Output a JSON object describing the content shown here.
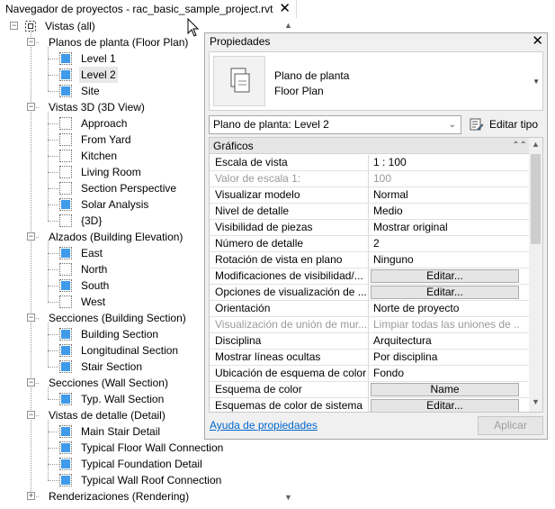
{
  "browser": {
    "title": "Navegador de proyectos - rac_basic_sample_project.rvt",
    "tree": [
      {
        "label": "Vistas (all)",
        "level": 0,
        "type": "group-root"
      },
      {
        "label": "Planos de planta (Floor Plan)",
        "level": 1,
        "type": "group"
      },
      {
        "label": "Level 1",
        "level": 2,
        "type": "view",
        "icon": "blue"
      },
      {
        "label": "Level 2",
        "level": 2,
        "type": "view",
        "icon": "blue",
        "selected": true
      },
      {
        "label": "Site",
        "level": 2,
        "type": "view",
        "icon": "blue"
      },
      {
        "label": "Vistas 3D (3D View)",
        "level": 1,
        "type": "group"
      },
      {
        "label": "Approach",
        "level": 2,
        "type": "view",
        "icon": "empty"
      },
      {
        "label": "From Yard",
        "level": 2,
        "type": "view",
        "icon": "empty"
      },
      {
        "label": "Kitchen",
        "level": 2,
        "type": "view",
        "icon": "empty"
      },
      {
        "label": "Living Room",
        "level": 2,
        "type": "view",
        "icon": "empty"
      },
      {
        "label": "Section Perspective",
        "level": 2,
        "type": "view",
        "icon": "empty"
      },
      {
        "label": "Solar Analysis",
        "level": 2,
        "type": "view",
        "icon": "blue"
      },
      {
        "label": "{3D}",
        "level": 2,
        "type": "view",
        "icon": "empty"
      },
      {
        "label": "Alzados (Building Elevation)",
        "level": 1,
        "type": "group"
      },
      {
        "label": "East",
        "level": 2,
        "type": "view",
        "icon": "blue"
      },
      {
        "label": "North",
        "level": 2,
        "type": "view",
        "icon": "empty"
      },
      {
        "label": "South",
        "level": 2,
        "type": "view",
        "icon": "blue"
      },
      {
        "label": "West",
        "level": 2,
        "type": "view",
        "icon": "empty"
      },
      {
        "label": "Secciones (Building Section)",
        "level": 1,
        "type": "group"
      },
      {
        "label": "Building Section",
        "level": 2,
        "type": "view",
        "icon": "blue"
      },
      {
        "label": "Longitudinal Section",
        "level": 2,
        "type": "view",
        "icon": "blue"
      },
      {
        "label": "Stair Section",
        "level": 2,
        "type": "view",
        "icon": "blue"
      },
      {
        "label": "Secciones (Wall Section)",
        "level": 1,
        "type": "group"
      },
      {
        "label": "Typ. Wall Section",
        "level": 2,
        "type": "view",
        "icon": "blue"
      },
      {
        "label": "Vistas de detalle (Detail)",
        "level": 1,
        "type": "group"
      },
      {
        "label": "Main Stair Detail",
        "level": 2,
        "type": "view",
        "icon": "blue"
      },
      {
        "label": "Typical Floor Wall Connection",
        "level": 2,
        "type": "view",
        "icon": "blue"
      },
      {
        "label": "Typical Foundation Detail",
        "level": 2,
        "type": "view",
        "icon": "blue"
      },
      {
        "label": "Typical Wall Roof Connection",
        "level": 2,
        "type": "view",
        "icon": "blue"
      },
      {
        "label": "Renderizaciones (Rendering)",
        "level": 1,
        "type": "group-collapsed"
      }
    ]
  },
  "props": {
    "title": "Propiedades",
    "type_name_line1": "Plano de planta",
    "type_name_line2": "Floor Plan",
    "instance_selector": "Plano de planta: Level 2",
    "edit_type_label": "Editar tipo",
    "group_header": "Gráficos",
    "rows": [
      {
        "name": "Escala de vista",
        "value": "1 : 100"
      },
      {
        "name": "Valor de escala    1:",
        "value": "100",
        "disabled": true
      },
      {
        "name": "Visualizar modelo",
        "value": "Normal"
      },
      {
        "name": "Nivel de detalle",
        "value": "Medio"
      },
      {
        "name": "Visibilidad de piezas",
        "value": "Mostrar original"
      },
      {
        "name": "Número de detalle",
        "value": "2"
      },
      {
        "name": "Rotación de vista en plano",
        "value": "Ninguno"
      },
      {
        "name": "Modificaciones de visibilidad/...",
        "value": "Editar...",
        "button": true
      },
      {
        "name": "Opciones de visualización de ...",
        "value": "Editar...",
        "button": true
      },
      {
        "name": "Orientación",
        "value": "Norte de proyecto"
      },
      {
        "name": "Visualización de unión de mur...",
        "value": "Limpiar todas las uniones de ...",
        "disabled": true
      },
      {
        "name": "Disciplina",
        "value": "Arquitectura"
      },
      {
        "name": "Mostrar líneas ocultas",
        "value": "Por disciplina"
      },
      {
        "name": "Ubicación de esquema de color",
        "value": "Fondo"
      },
      {
        "name": "Esquema de color",
        "value": "Name",
        "button": true
      },
      {
        "name": "Esquemas de color de sistema",
        "value": "Editar...",
        "button": true
      }
    ],
    "help_link": "Ayuda de propiedades",
    "apply_label": "Aplicar"
  },
  "colors": {
    "view_icon_blue": "#3f9bea",
    "link": "#0066cc"
  }
}
